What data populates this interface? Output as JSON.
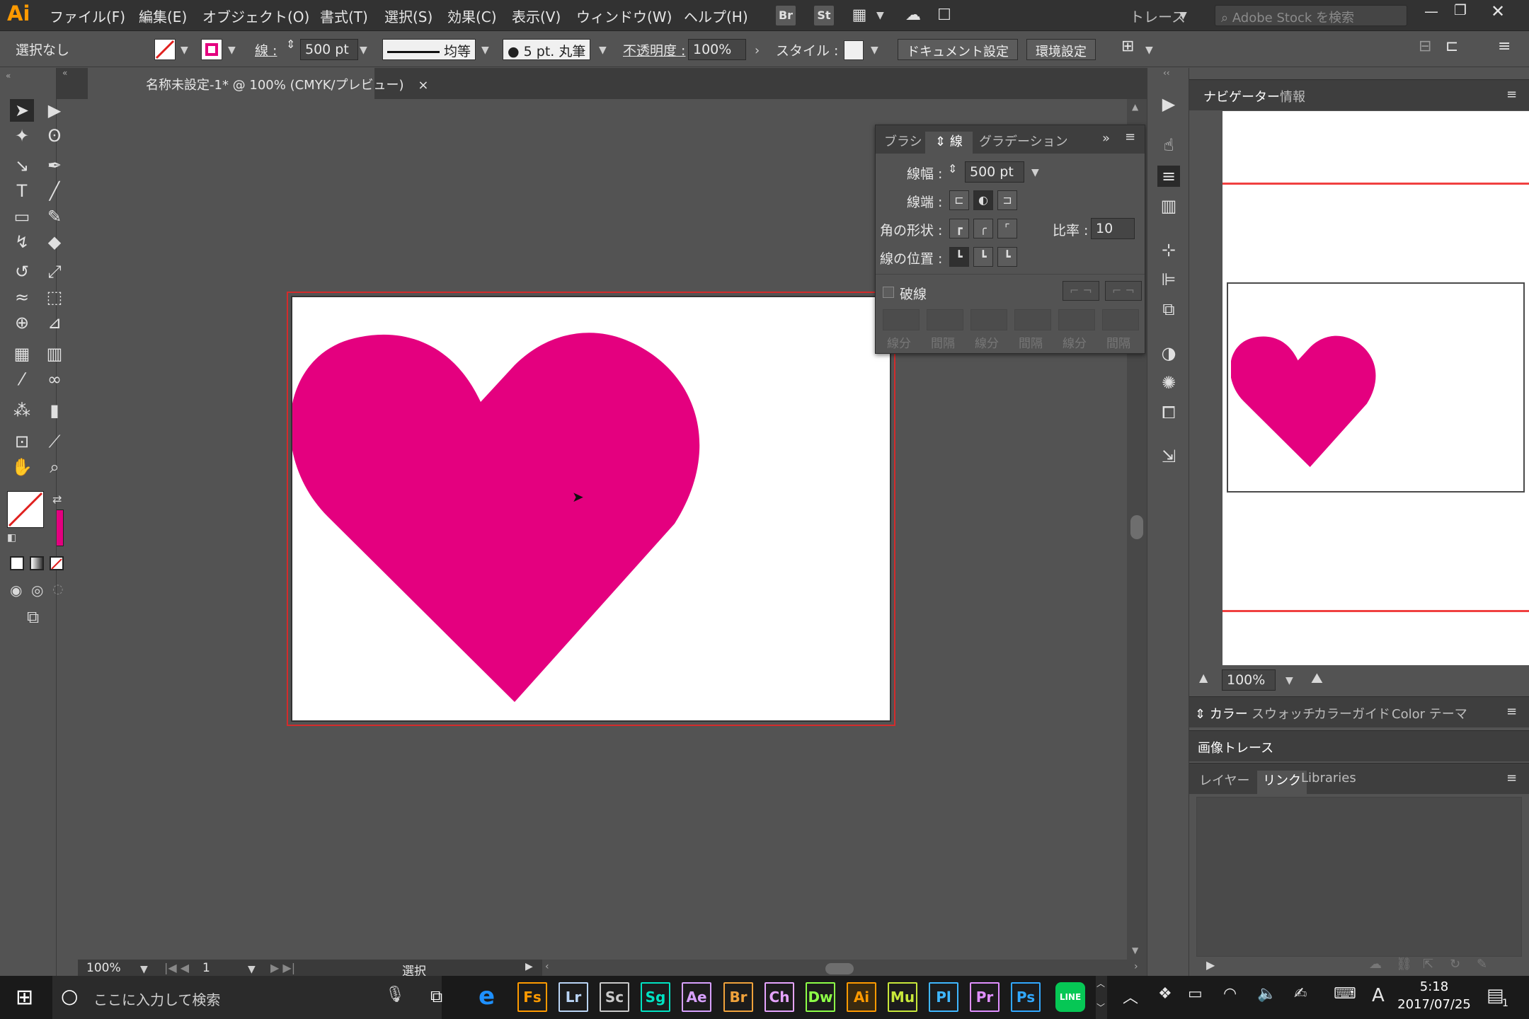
{
  "app": {
    "logo": "Ai"
  },
  "menu": [
    "ファイル(F)",
    "編集(E)",
    "オブジェクト(O)",
    "書式(T)",
    "選択(S)",
    "効果(C)",
    "表示(V)",
    "ウィンドウ(W)",
    "ヘルプ(H)"
  ],
  "menu_icons": [
    "Br",
    "St"
  ],
  "workspace": "トレース",
  "search_placeholder": "Adobe Stock を検索",
  "control": {
    "selection": "選択なし",
    "stroke_label": "線 :",
    "stroke_width": "500 pt",
    "stroke_profile": "均等",
    "brush": "5 pt. 丸筆",
    "opacity_label": "不透明度 :",
    "opacity": "100%",
    "style_label": "スタイル :",
    "doc_settings": "ドキュメント設定",
    "prefs": "環境設定"
  },
  "document": {
    "tab_title": "名称未設定-1* @ 100% (CMYK/プレビュー)",
    "close": "×"
  },
  "status": {
    "zoom": "100%",
    "page": "1",
    "tool": "選択"
  },
  "stroke_panel": {
    "tabs": [
      "ブラシ",
      "線",
      "グラデーション"
    ],
    "active_tab": "線",
    "width_label": "線幅 :",
    "width": "500 pt",
    "cap_label": "線端 :",
    "corner_label": "角の形状 :",
    "ratio_label": "比率 :",
    "ratio": "10",
    "align_label": "線の位置 :",
    "dashed_label": "破線",
    "dash_labels": [
      "線分",
      "間隔",
      "線分",
      "間隔",
      "線分",
      "間隔"
    ]
  },
  "navigator": {
    "tabs": [
      "ナビゲーター",
      "情報"
    ],
    "zoom": "100%"
  },
  "color_panel": {
    "tabs": [
      "カラー",
      "スウォッチ",
      "カラーガイド",
      "Color テーマ"
    ]
  },
  "trace_panel": {
    "title": "画像トレース"
  },
  "layers_panel": {
    "tabs": [
      "レイヤー",
      "リンク",
      "Libraries"
    ]
  },
  "colors": {
    "heart": "#e4007f",
    "accent_red": "#d42b2b"
  },
  "taskbar": {
    "search": "ここに入力して検索",
    "apps": [
      {
        "label": "Fs",
        "color": "#ff9a00"
      },
      {
        "label": "Lr",
        "color": "#b9d4f5"
      },
      {
        "label": "Sc",
        "color": "#c9c9c9"
      },
      {
        "label": "Sg",
        "color": "#00e2c2"
      },
      {
        "label": "Ae",
        "color": "#d8a1ff"
      },
      {
        "label": "Br",
        "color": "#f0a23b"
      },
      {
        "label": "Ch",
        "color": "#e6a4ff"
      },
      {
        "label": "Dw",
        "color": "#8dff47"
      },
      {
        "label": "Ai",
        "color": "#ff9a00"
      },
      {
        "label": "Mu",
        "color": "#c8e83a"
      },
      {
        "label": "Pl",
        "color": "#3fb7ff"
      },
      {
        "label": "Pr",
        "color": "#e08fff"
      },
      {
        "label": "Ps",
        "color": "#31a8ff"
      }
    ],
    "ime": "A",
    "time": "5:18",
    "date": "2017/07/25",
    "notifications": "1"
  }
}
